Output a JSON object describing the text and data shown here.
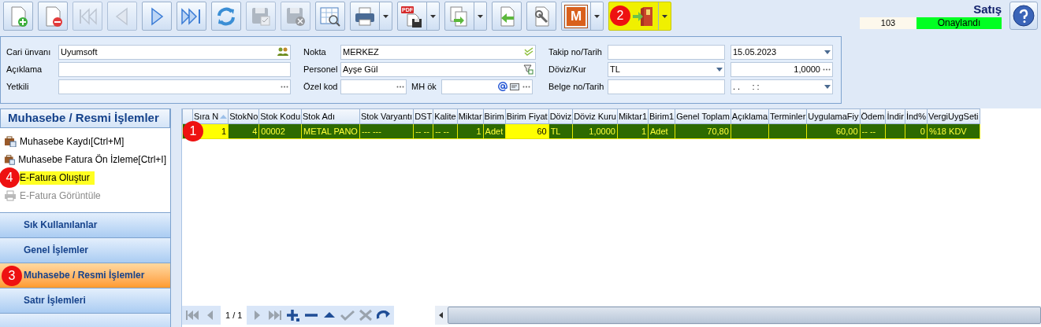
{
  "toolbar": [
    {
      "kind": "new",
      "disabled": false,
      "dropdown": false
    },
    {
      "kind": "delete",
      "disabled": false,
      "dropdown": false
    },
    {
      "kind": "first",
      "disabled": true,
      "dropdown": false
    },
    {
      "kind": "prev",
      "disabled": true,
      "dropdown": false
    },
    {
      "kind": "next",
      "disabled": false,
      "dropdown": false
    },
    {
      "kind": "last",
      "disabled": false,
      "dropdown": false
    },
    {
      "kind": "refresh",
      "disabled": false,
      "dropdown": false
    },
    {
      "kind": "save",
      "disabled": true,
      "dropdown": false
    },
    {
      "kind": "save-cancel",
      "disabled": true,
      "dropdown": false
    },
    {
      "kind": "grid-search",
      "disabled": false,
      "dropdown": false
    },
    {
      "kind": "print",
      "disabled": false,
      "dropdown": true
    },
    {
      "kind": "pdf",
      "disabled": false,
      "dropdown": true,
      "label": "PDF"
    },
    {
      "kind": "export",
      "disabled": false,
      "dropdown": true
    },
    {
      "kind": "import",
      "disabled": false,
      "dropdown": false
    },
    {
      "kind": "tools",
      "disabled": false,
      "dropdown": false
    },
    {
      "kind": "letter",
      "disabled": false,
      "dropdown": true,
      "label": "M"
    },
    {
      "kind": "exit",
      "disabled": false,
      "dropdown": true,
      "highlighted": true,
      "annotation": "2"
    }
  ],
  "header": {
    "title": "Satış",
    "number": "103",
    "status": "Onaylandı"
  },
  "form": [
    [
      {
        "parts": [
          {
            "kind": "label",
            "text": "Cari ünvanı"
          },
          {
            "kind": "input",
            "value": "Uyumsoft"
          }
        ]
      },
      {
        "parts": [
          {
            "kind": "label",
            "text": "Açıklama"
          },
          {
            "kind": "input"
          }
        ]
      },
      {
        "parts": [
          {
            "kind": "label",
            "text": "Yetkili"
          },
          {
            "kind": "input"
          }
        ]
      }
    ],
    [
      {
        "parts": [
          {
            "kind": "label",
            "text": "Nokta"
          },
          {
            "kind": "input",
            "value": "MERKEZ"
          }
        ]
      },
      {
        "parts": [
          {
            "kind": "label",
            "text": "Personel"
          },
          {
            "kind": "input",
            "value": "Ayşe Gül"
          }
        ]
      },
      {
        "parts": [
          {
            "kind": "label",
            "text": "Özel kod"
          },
          {
            "kind": "input"
          },
          {
            "kind": "label",
            "text": "MH ök"
          },
          {
            "kind": "input"
          }
        ]
      }
    ],
    [
      {
        "parts": [
          {
            "kind": "label",
            "text": "Takip no/Tarih"
          },
          {
            "kind": "input"
          },
          {
            "kind": "input",
            "value": "15.05.2023"
          }
        ]
      },
      {
        "parts": [
          {
            "kind": "label",
            "text": "Döviz/Kur"
          },
          {
            "kind": "input",
            "value": "TL"
          },
          {
            "kind": "input",
            "value": "1,0000"
          }
        ]
      },
      {
        "parts": [
          {
            "kind": "label",
            "text": "Belge no/Tarih"
          },
          {
            "kind": "input"
          },
          {
            "kind": "input",
            "value": ". .     : :"
          }
        ]
      }
    ]
  ],
  "side_panel": {
    "title": "Muhasebe / Resmi İşlemler",
    "items": [
      {
        "label": "Muhasebe Kaydı[Ctrl+M]",
        "highlighted": false,
        "disabled": false
      },
      {
        "label": "Muhasebe Fatura Ön İzleme[Ctrl+I]",
        "highlighted": false,
        "disabled": false
      },
      {
        "label": "E-Fatura Oluştur",
        "highlighted": true,
        "disabled": false,
        "annotation": "4"
      },
      {
        "label": "E-Fatura Görüntüle",
        "highlighted": false,
        "disabled": true
      }
    ],
    "groups": [
      {
        "label": "Sık Kullanılanlar",
        "selected": false
      },
      {
        "label": "Genel İşlemler",
        "selected": false
      },
      {
        "label": "Muhasebe / Resmi İşlemler",
        "selected": true,
        "annotation": "3"
      },
      {
        "label": "Satır İşlemleri",
        "selected": false
      }
    ]
  },
  "table": {
    "columns": [
      {
        "label": "Sıra N",
        "kind": "number",
        "sorted": true
      },
      {
        "label": "StokNo",
        "kind": "number"
      },
      {
        "label": "Stok Kodu",
        "kind": "text"
      },
      {
        "label": "Stok Adı",
        "kind": "text"
      },
      {
        "label": "Stok Varyantı",
        "kind": "text"
      },
      {
        "label": "DST",
        "kind": "text"
      },
      {
        "label": "Kalite",
        "kind": "text"
      },
      {
        "label": "Miktar",
        "kind": "number"
      },
      {
        "label": "Birim",
        "kind": "text"
      },
      {
        "label": "Birim Fiyat",
        "kind": "number"
      },
      {
        "label": "Döviz",
        "kind": "text"
      },
      {
        "label": "Döviz Kuru",
        "kind": "number"
      },
      {
        "label": "Miktar1",
        "kind": "number"
      },
      {
        "label": "Birim1",
        "kind": "text"
      },
      {
        "label": "Genel Toplam",
        "kind": "number"
      },
      {
        "label": "Açıklama",
        "kind": "text"
      },
      {
        "label": "Terminler",
        "kind": "text"
      },
      {
        "label": "UygulamaFiy",
        "kind": "number"
      },
      {
        "label": "Ödem",
        "kind": "text"
      },
      {
        "label": "İndir",
        "kind": "number"
      },
      {
        "label": "İnd%",
        "kind": "number"
      },
      {
        "label": "VergiUygSeti",
        "kind": "text"
      }
    ],
    "rows": [
      {
        "selected": true,
        "annotation": "1",
        "cells": [
          {
            "text": "1",
            "highlighted": true
          },
          {
            "text": "4",
            "highlighted": false
          },
          {
            "text": "00002",
            "highlighted": false
          },
          {
            "text": "METAL PANO",
            "highlighted": false
          },
          {
            "text": "--- ---",
            "highlighted": false
          },
          {
            "text": "-- --",
            "highlighted": false
          },
          {
            "text": "-- --",
            "highlighted": false
          },
          {
            "text": "1",
            "highlighted": false
          },
          {
            "text": "Adet",
            "highlighted": false
          },
          {
            "text": "60",
            "highlighted": true
          },
          {
            "text": "TL",
            "highlighted": false
          },
          {
            "text": "1,0000",
            "highlighted": false
          },
          {
            "text": "1",
            "highlighted": false
          },
          {
            "text": "Adet",
            "highlighted": false
          },
          {
            "text": "70,80",
            "highlighted": false
          },
          {
            "highlighted": false
          },
          {
            "highlighted": false
          },
          {
            "text": "60,00",
            "highlighted": false
          },
          {
            "text": "-- --",
            "highlighted": false
          },
          {
            "highlighted": false
          },
          {
            "text": "0",
            "highlighted": false
          },
          {
            "text": "%18 KDV",
            "highlighted": false
          }
        ]
      }
    ]
  },
  "pager": {
    "text": "1 / 1",
    "buttons": [
      {
        "kind": "first",
        "disabled": true
      },
      {
        "kind": "prev",
        "disabled": true
      },
      {
        "kind": "next",
        "disabled": true
      },
      {
        "kind": "last",
        "disabled": true
      },
      {
        "kind": "add",
        "disabled": false
      },
      {
        "kind": "remove",
        "disabled": false
      },
      {
        "kind": "up",
        "disabled": false
      },
      {
        "kind": "check",
        "disabled": true
      },
      {
        "kind": "cancel",
        "disabled": true
      },
      {
        "kind": "redo",
        "disabled": false
      }
    ]
  }
}
